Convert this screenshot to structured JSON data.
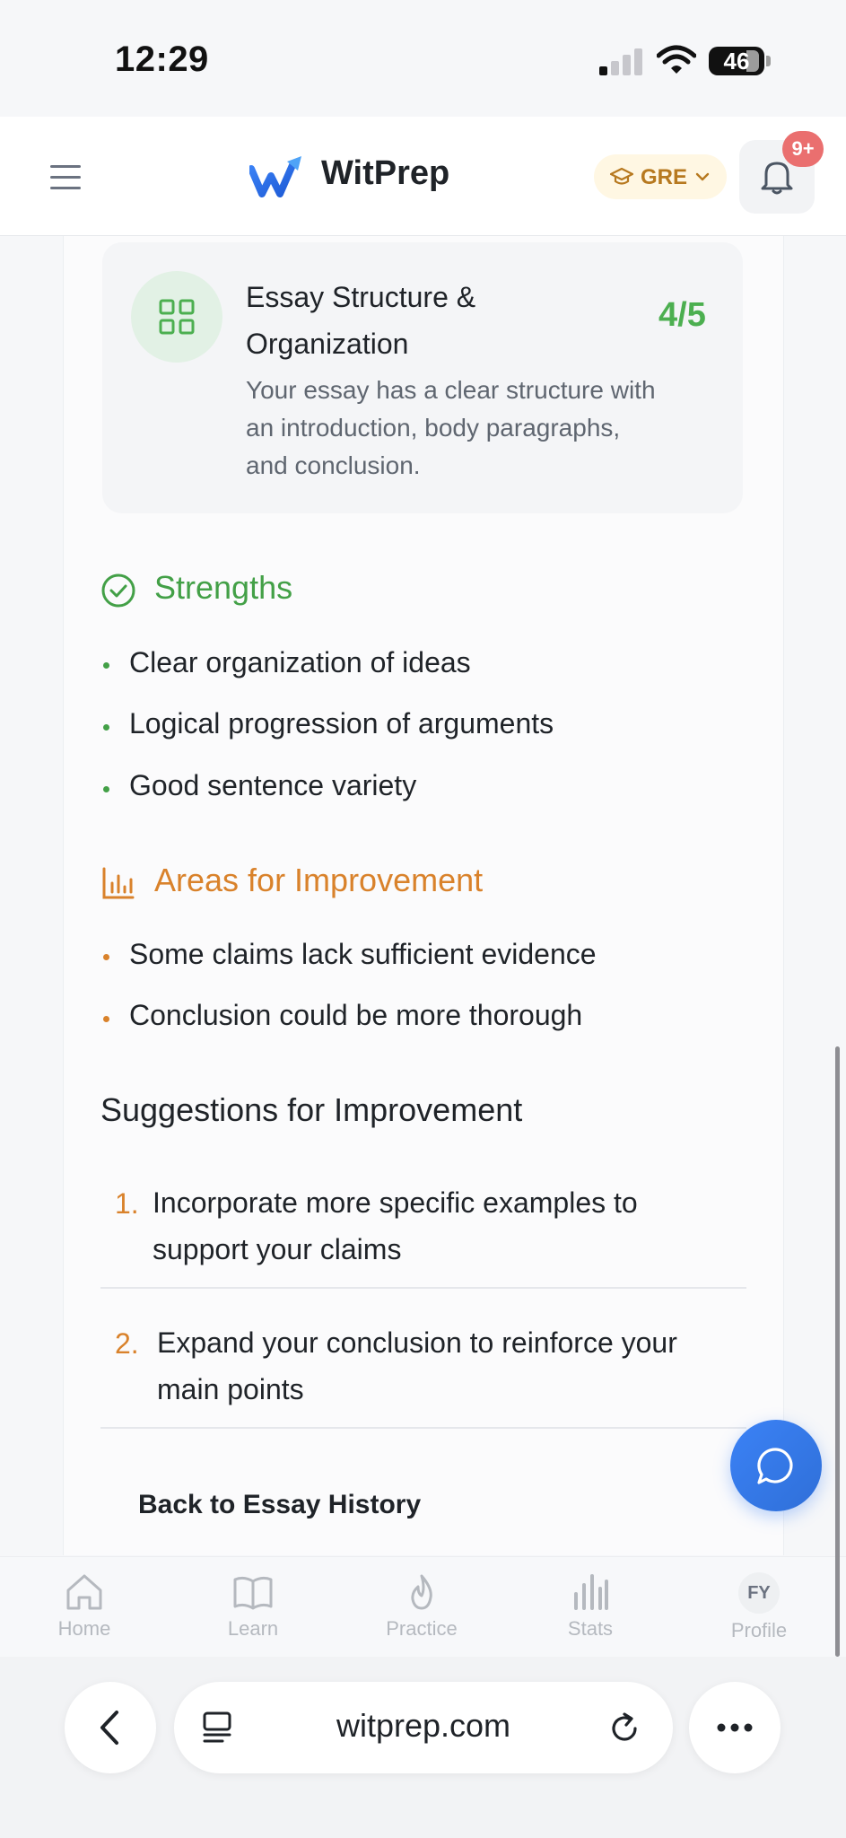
{
  "status_bar": {
    "time": "12:29",
    "battery": "46"
  },
  "header": {
    "brand": "WitPrep",
    "exam_selector": "GRE",
    "notification_badge": "9+"
  },
  "criteria": {
    "title_line1": "Essay Structure &",
    "title_line2": "Organization",
    "score": "4/5",
    "description_lines": [
      "Your essay has a clear structure with",
      "an introduction, body paragraphs,",
      "and conclusion."
    ]
  },
  "strengths": {
    "title": "Strengths",
    "items": [
      "Clear organization of ideas",
      "Logical progression of arguments",
      "Good sentence variety"
    ]
  },
  "areas": {
    "title": "Areas for Improvement",
    "items": [
      "Some claims lack sufficient evidence",
      "Conclusion could be more thorough"
    ]
  },
  "suggestions": {
    "title": "Suggestions for Improvement",
    "items": [
      {
        "num": "1.",
        "line1": "Incorporate more specific examples to",
        "line2": "support your claims"
      },
      {
        "num": "2.",
        "line1": "Expand your conclusion to reinforce your",
        "line2": "main points"
      }
    ]
  },
  "back_link": "Back to Essay History",
  "bottom_nav": [
    {
      "label": "Home",
      "icon": "home-icon"
    },
    {
      "label": "Learn",
      "icon": "book-icon"
    },
    {
      "label": "Practice",
      "icon": "flame-icon"
    },
    {
      "label": "Stats",
      "icon": "bar-chart-icon"
    },
    {
      "label": "Profile",
      "initials": "FY"
    }
  ],
  "browser": {
    "url": "witprep.com"
  },
  "colors": {
    "green": "#43a047",
    "orange": "#d9822b",
    "blue": "#3b82f6"
  }
}
